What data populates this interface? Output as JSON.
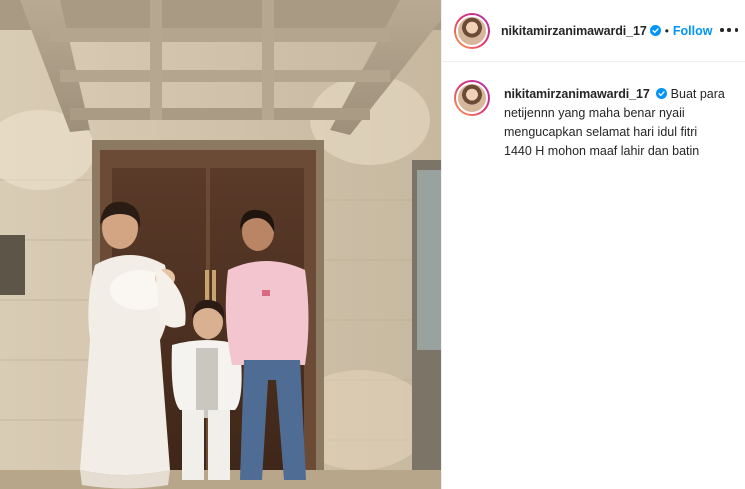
{
  "post": {
    "author": {
      "username": "nikitamirzanimawardi_17",
      "verified": true,
      "avatar": "profile-photo"
    },
    "header": {
      "separator": "•",
      "follow_label": "Follow",
      "more_icon": "more-options-icon"
    },
    "caption": {
      "lines": [
        "Buat para",
        "netijennn yang maha benar nyaii",
        "mengucapkan selamat hari idul fitri",
        "1440 H mohon maaf lahir dan batin"
      ]
    },
    "photo": {
      "description_icon": "family-photo"
    }
  },
  "colors": {
    "accent": "#0095f6",
    "text": "#262626",
    "divider": "#efefef",
    "story_ring_start": "#f9a84f",
    "story_ring_mid": "#e1306c",
    "story_ring_end": "#a634b6"
  }
}
